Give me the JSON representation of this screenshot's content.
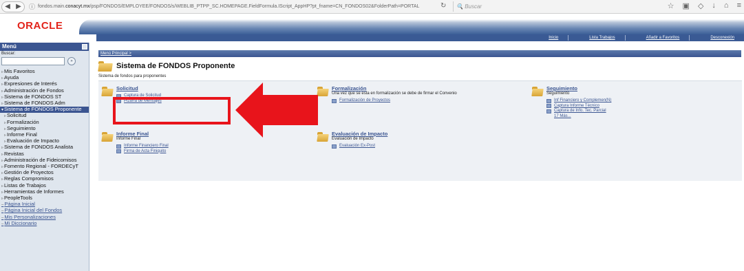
{
  "browser": {
    "url_info": "ⓘ",
    "url_prefix": "fondos.main.",
    "url_domain": "conacyt.mx",
    "url_rest": "/psp/FONDOS/EMPLOYEE/FONDOS/s/WEBLIB_PTPP_SC.HOMEPAGE.FieldFormula.IScript_AppHP?pt_fname=CN_FONDOS02&FolderPath=PORTAL",
    "search_placeholder": "Buscar"
  },
  "header": {
    "logo": "ORACLE",
    "links": [
      "Inicio",
      "Lista Trabajos",
      "Añadir a Favoritos",
      "Desconexión"
    ]
  },
  "sidebar": {
    "title": "Menú",
    "search_label": "Buscar:",
    "go_label": "»",
    "items": [
      {
        "label": "Mis Favoritos",
        "type": "node"
      },
      {
        "label": "Ayuda",
        "type": "node"
      },
      {
        "label": "Expresiones de Interés",
        "type": "node"
      },
      {
        "label": "Administración de Fondos",
        "type": "node"
      },
      {
        "label": "Sistema de FONDOS ST",
        "type": "node"
      },
      {
        "label": "Sistema de FONDOS Adm",
        "type": "node"
      },
      {
        "label": "Sistema de FONDOS Proponente",
        "type": "active"
      },
      {
        "label": "Solicitud",
        "type": "sub"
      },
      {
        "label": "Formalización",
        "type": "sub"
      },
      {
        "label": "Seguimiento",
        "type": "sub"
      },
      {
        "label": "Informe Final",
        "type": "sub"
      },
      {
        "label": "Evaluación de Impacto",
        "type": "sub"
      },
      {
        "label": "Sistema de FONDOS Analista",
        "type": "wrap"
      },
      {
        "label": "Revistas",
        "type": "node"
      },
      {
        "label": "Administración de Fideicomisos",
        "type": "wrap"
      },
      {
        "label": "Fomento Regional - FORDECyT",
        "type": "wrap"
      },
      {
        "label": "Gestión de Proyectos",
        "type": "node"
      },
      {
        "label": "Reglas Compromisos",
        "type": "node"
      },
      {
        "label": "Listas de Trabajos",
        "type": "node"
      },
      {
        "label": "Herramientas de Informes",
        "type": "node"
      },
      {
        "label": "PeopleTools",
        "type": "node"
      },
      {
        "label": "Página Inicial",
        "type": "link"
      },
      {
        "label": "Página Inicial del Fondos",
        "type": "link"
      },
      {
        "label": "Mis Personalizaciones",
        "type": "link"
      },
      {
        "label": "Mi Diccionario",
        "type": "link"
      }
    ]
  },
  "main": {
    "breadcrumb": "Menú Principal >",
    "title": "Sistema de FONDOS Proponente",
    "subtitle": "Sistema de fondos para proponentes",
    "sections": [
      {
        "title": "Solicitud",
        "desc": "",
        "links": [
          "Captura de Solicitud",
          "Pizarra de Mensajes"
        ],
        "more": ""
      },
      {
        "title": "Formalización",
        "desc": "Una vez que se esta en formalización se debe de firmar el Convenio",
        "links": [
          "Formalización de Proyectos"
        ],
        "more": ""
      },
      {
        "title": "Seguimiento",
        "desc": "Seguimiento",
        "links": [
          "Inf Financiero y Complemen(N)",
          "Captura Informe Técnico",
          "Captura de Info. Tec. Parcial"
        ],
        "more": "17 Más..."
      },
      {
        "title": "Informe Final",
        "desc": "Informe Final",
        "links": [
          "Informe Financiero Final",
          "Firma de Acta Finiquito"
        ],
        "more": ""
      },
      {
        "title": "Evaluación de Impacto",
        "desc": "Evaluación de Impacto",
        "links": [
          "Evaluación Ex-Post"
        ],
        "more": ""
      }
    ]
  },
  "colors": {
    "accent": "#3b5591",
    "annotation": "#e8141b",
    "logo": "#e2231a"
  }
}
